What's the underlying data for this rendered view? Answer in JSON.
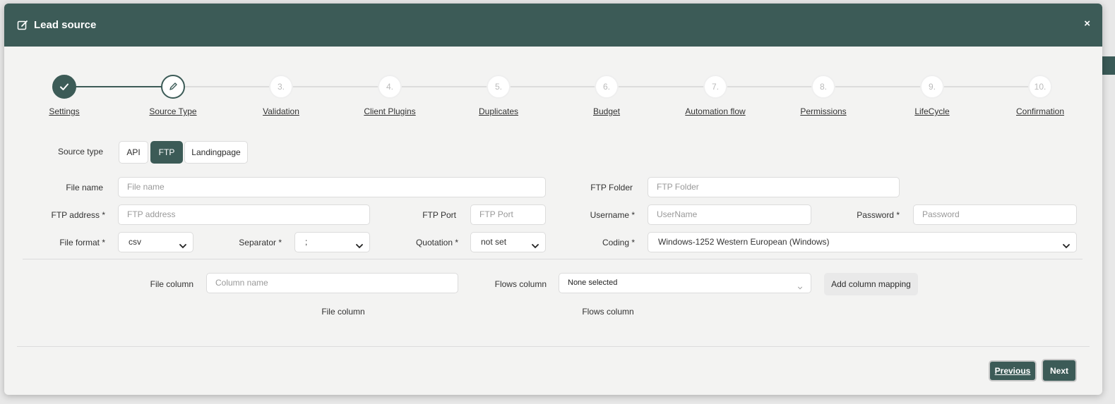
{
  "header": {
    "title": "Lead source",
    "close_glyph": "×"
  },
  "stepper": {
    "steps": [
      {
        "num": "✓",
        "label": "Settings",
        "state": "done"
      },
      {
        "num": "",
        "label": "Source Type",
        "state": "active"
      },
      {
        "num": "3.",
        "label": "Validation",
        "state": "pending"
      },
      {
        "num": "4.",
        "label": "Client Plugins",
        "state": "pending"
      },
      {
        "num": "5.",
        "label": "Duplicates",
        "state": "pending"
      },
      {
        "num": "6.",
        "label": "Budget",
        "state": "pending"
      },
      {
        "num": "7.",
        "label": "Automation flow",
        "state": "pending"
      },
      {
        "num": "8.",
        "label": "Permissions",
        "state": "pending"
      },
      {
        "num": "9.",
        "label": "LifeCycle",
        "state": "pending"
      },
      {
        "num": "10.",
        "label": "Confirmation",
        "state": "pending"
      }
    ]
  },
  "source_type": {
    "label": "Source type",
    "options": [
      "API",
      "FTP",
      "Landingpage"
    ],
    "selected": "FTP"
  },
  "form": {
    "file_name": {
      "label": "File name",
      "placeholder": "File name"
    },
    "ftp_folder": {
      "label": "FTP Folder",
      "placeholder": "FTP Folder"
    },
    "ftp_address": {
      "label": "FTP address *",
      "placeholder": "FTP address"
    },
    "ftp_port": {
      "label": "FTP Port",
      "placeholder": "FTP Port"
    },
    "username": {
      "label": "Username *",
      "placeholder": "UserName"
    },
    "password": {
      "label": "Password *",
      "placeholder": "Password"
    },
    "file_format": {
      "label": "File format *",
      "value": "csv"
    },
    "separator": {
      "label": "Separator *",
      "value": ";"
    },
    "quotation": {
      "label": "Quotation *",
      "value": "not set"
    },
    "coding": {
      "label": "Coding *",
      "value": "Windows-1252 Western European (Windows)"
    }
  },
  "mapping": {
    "file_column_label": "File column",
    "file_column_placeholder": "Column name",
    "flows_column_label": "Flows column",
    "flows_column_value": "None selected",
    "add_button": "Add column mapping",
    "table_header_file": "File column",
    "table_header_flows": "Flows column"
  },
  "footer": {
    "previous": "Previous",
    "next": "Next"
  },
  "colors": {
    "primary": "#3c5b57",
    "background": "#f3f3f2"
  },
  "icons": {
    "header": "edit-icon",
    "step_done": "check-icon",
    "step_active": "pencil-icon",
    "select": "chevron-down-icon"
  }
}
